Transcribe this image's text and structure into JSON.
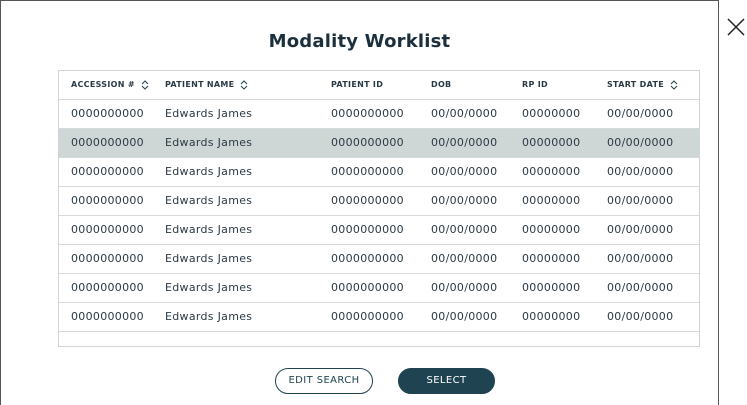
{
  "dialog": {
    "title": "Modality Worklist",
    "close_icon": "close-icon"
  },
  "table": {
    "columns": [
      {
        "label": "ACCESSION #",
        "sortable": true
      },
      {
        "label": "PATIENT NAME",
        "sortable": true
      },
      {
        "label": "PATIENT ID",
        "sortable": false
      },
      {
        "label": "DOB",
        "sortable": false
      },
      {
        "label": "RP ID",
        "sortable": false
      },
      {
        "label": "START DATE",
        "sortable": true
      }
    ],
    "rows": [
      {
        "accession": "0000000000",
        "patient_name": "Edwards James",
        "patient_id": "0000000000",
        "dob": "00/00/0000",
        "rp_id": "00000000",
        "start_date": "00/00/0000"
      },
      {
        "accession": "0000000000",
        "patient_name": "Edwards James",
        "patient_id": "0000000000",
        "dob": "00/00/0000",
        "rp_id": "00000000",
        "start_date": "00/00/0000"
      },
      {
        "accession": "0000000000",
        "patient_name": "Edwards James",
        "patient_id": "0000000000",
        "dob": "00/00/0000",
        "rp_id": "00000000",
        "start_date": "00/00/0000"
      },
      {
        "accession": "0000000000",
        "patient_name": "Edwards James",
        "patient_id": "0000000000",
        "dob": "00/00/0000",
        "rp_id": "00000000",
        "start_date": "00/00/0000"
      },
      {
        "accession": "0000000000",
        "patient_name": "Edwards James",
        "patient_id": "0000000000",
        "dob": "00/00/0000",
        "rp_id": "00000000",
        "start_date": "00/00/0000"
      },
      {
        "accession": "0000000000",
        "patient_name": "Edwards James",
        "patient_id": "0000000000",
        "dob": "00/00/0000",
        "rp_id": "00000000",
        "start_date": "00/00/0000"
      },
      {
        "accession": "0000000000",
        "patient_name": "Edwards James",
        "patient_id": "0000000000",
        "dob": "00/00/0000",
        "rp_id": "00000000",
        "start_date": "00/00/0000"
      },
      {
        "accession": "0000000000",
        "patient_name": "Edwards James",
        "patient_id": "0000000000",
        "dob": "00/00/0000",
        "rp_id": "00000000",
        "start_date": "00/00/0000"
      }
    ],
    "selected_row_index": 1
  },
  "actions": {
    "edit_search_label": "EDIT SEARCH",
    "select_label": "SELECT"
  },
  "colors": {
    "primary": "#1f4350",
    "selected_row": "#cfd6d6",
    "border": "#cfd4d7"
  }
}
